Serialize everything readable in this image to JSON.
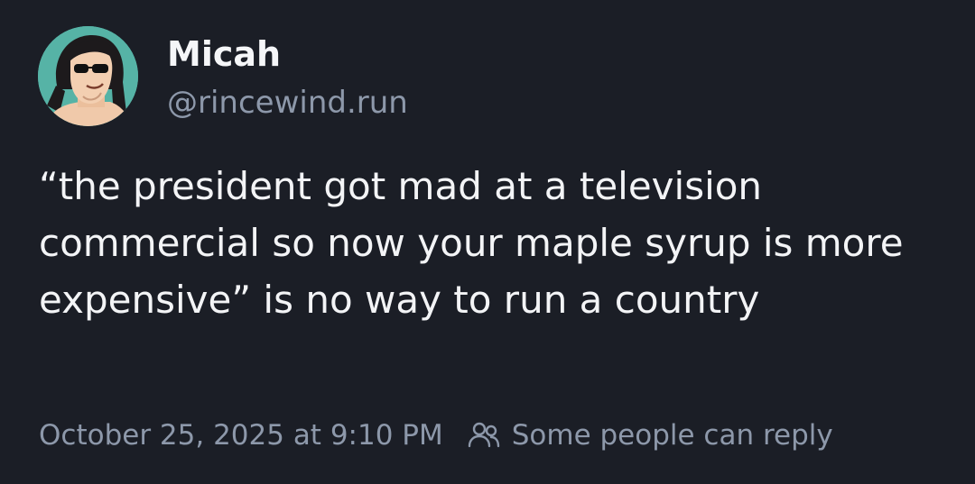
{
  "post": {
    "author": {
      "display_name": "Micah",
      "handle": "@rincewind.run",
      "avatar_icon": "cartoon-character-avatar"
    },
    "text": "“the president got mad at a television commercial so now your maple syrup is more expensive” is no way to run a country",
    "timestamp": "October 25, 2025 at 9:10 PM",
    "reply_setting": {
      "icon": "people-icon",
      "label": "Some people can reply"
    }
  },
  "colors": {
    "background": "#1b1e26",
    "primary_text": "#f3f4f6",
    "secondary_text": "#8d98aa",
    "avatar_background": "#56b3a6"
  }
}
